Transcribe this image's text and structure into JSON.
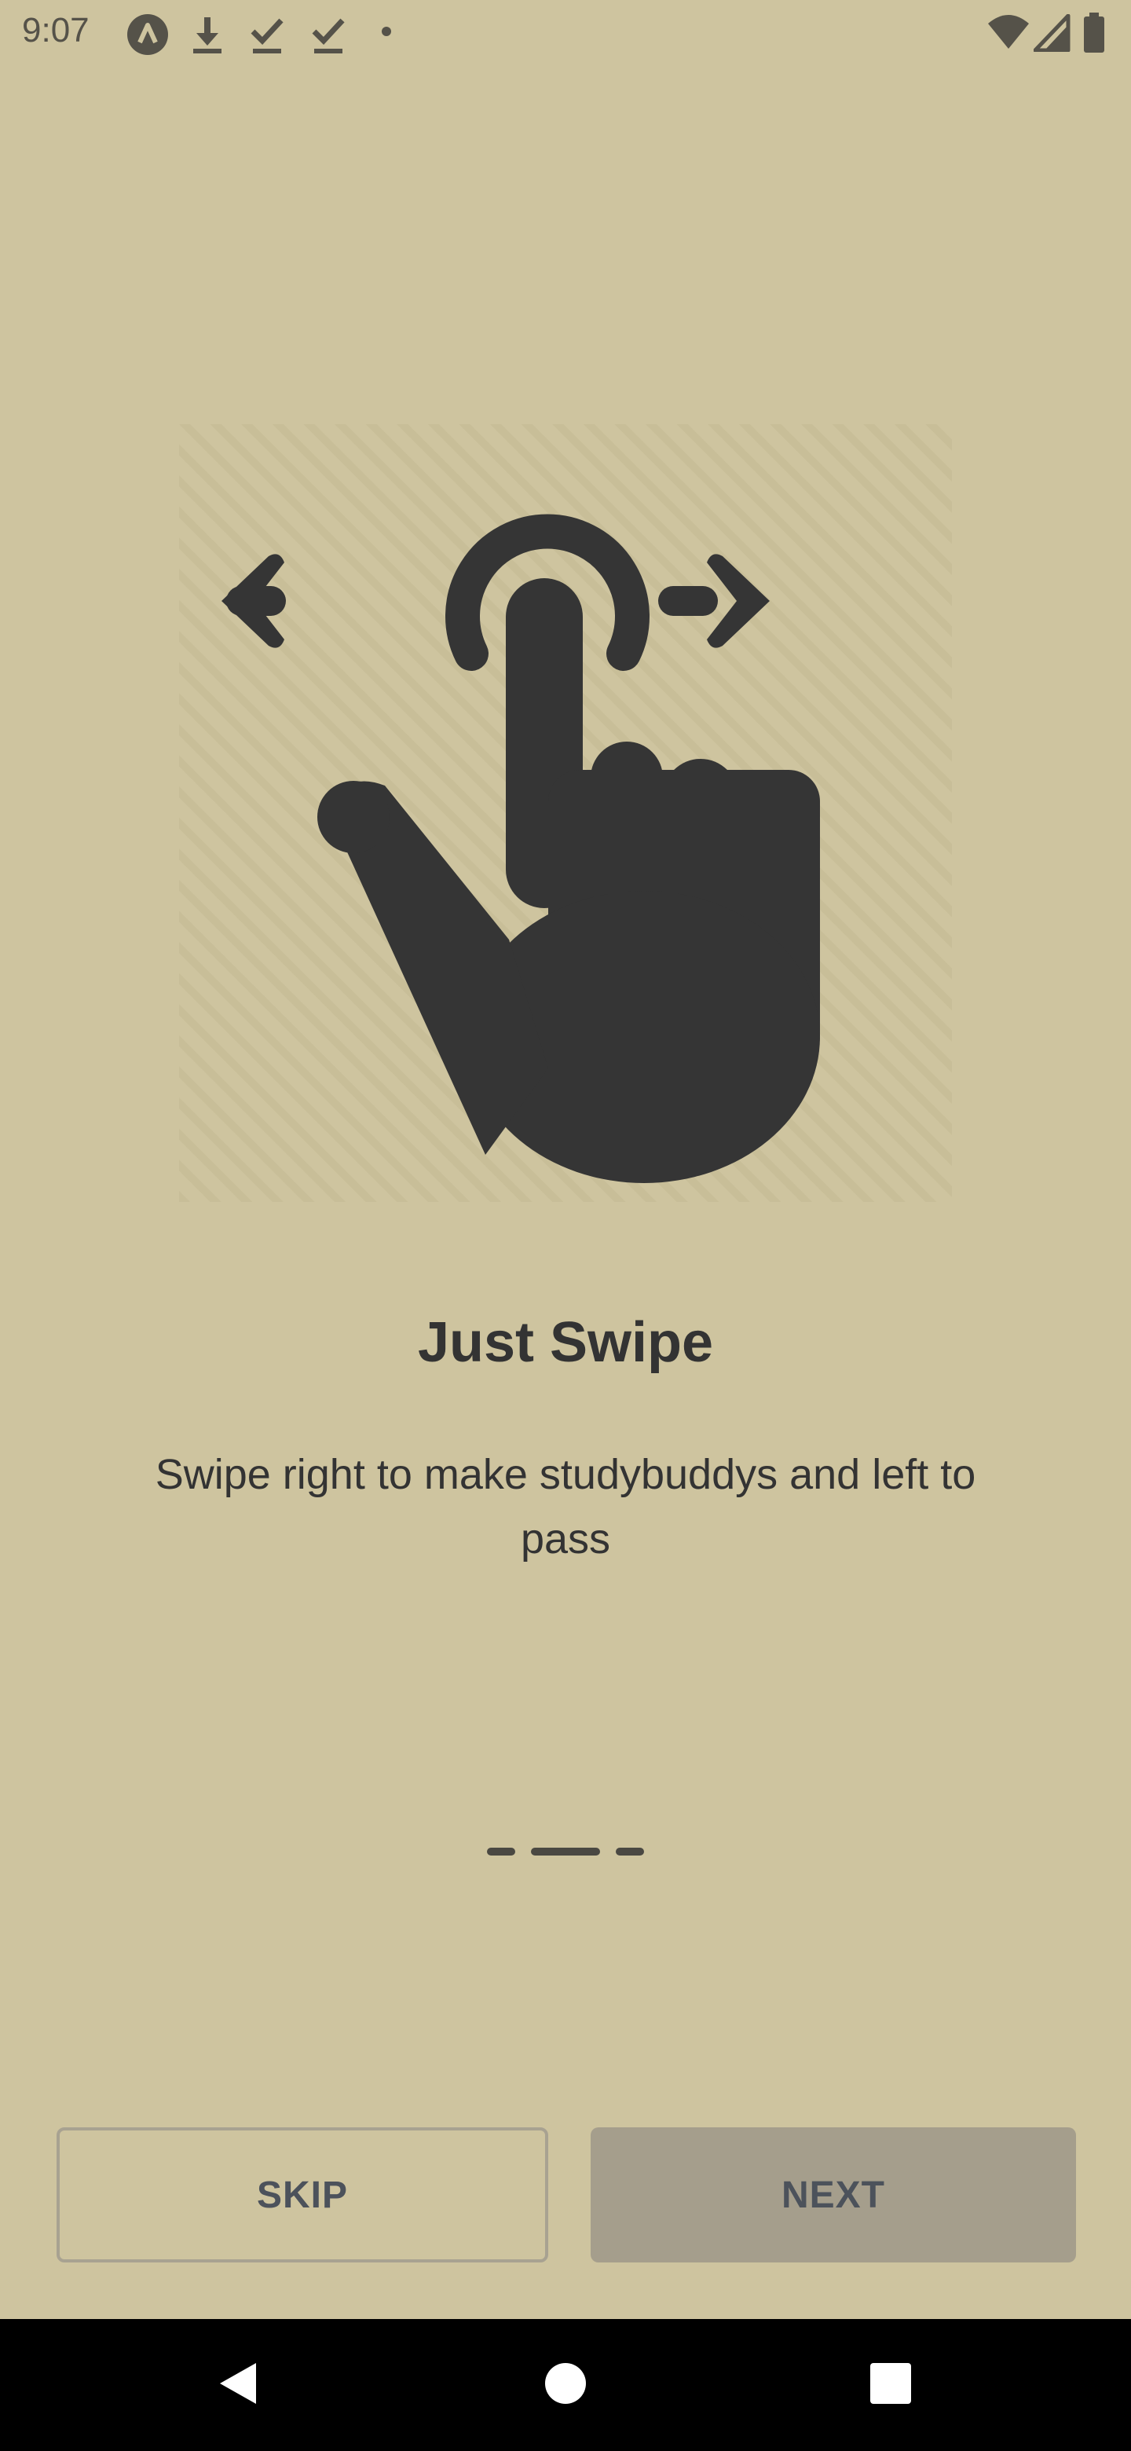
{
  "status_bar": {
    "time": "9:07",
    "left_icons": [
      "app-logo-icon",
      "download-icon",
      "download-done-icon",
      "download-done-icon",
      "dot-icon"
    ],
    "right_icons": [
      "wifi-icon",
      "cell-signal-icon",
      "battery-icon"
    ]
  },
  "onboarding": {
    "illustration_icon": "swipe-gesture-icon",
    "title": "Just Swipe",
    "description": "Swipe right to make studybuddys and left to pass",
    "page_count": 3,
    "active_page": 2
  },
  "buttons": {
    "skip_label": "SKIP",
    "next_label": "NEXT"
  },
  "nav_bar": {
    "icons": [
      "back-icon",
      "home-icon",
      "recents-icon"
    ]
  },
  "colors": {
    "background": "#cec49f",
    "text": "#333333",
    "button_text": "#4c525b",
    "next_button_fill": "#a59e8c",
    "skip_button_border": "#a8a291",
    "indicator": "#4a4842",
    "nav_bar": "#000000"
  }
}
